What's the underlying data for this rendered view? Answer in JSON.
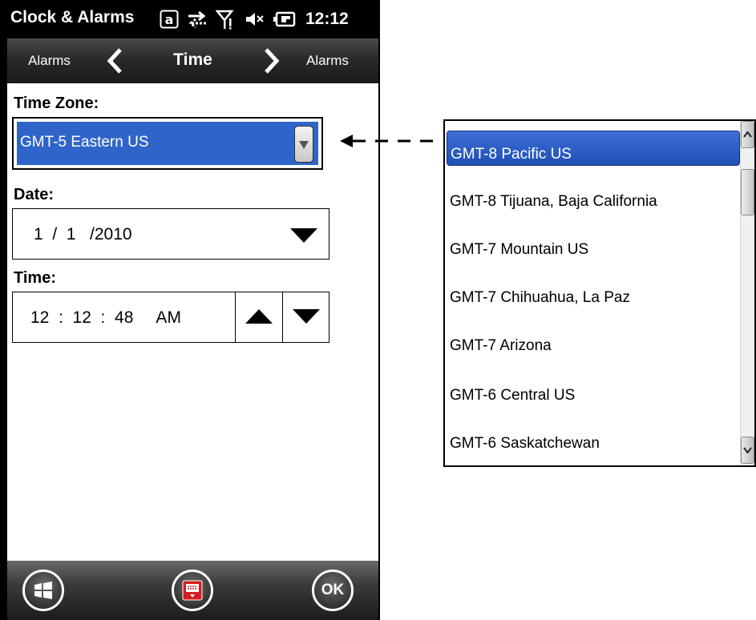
{
  "status_bar": {
    "app_title": "Clock & Alarms",
    "time": "12:12",
    "icons": [
      "keyboard-a-icon",
      "sync-arrows-icon",
      "signal-icon",
      "speaker-muted-icon",
      "battery-charging-icon"
    ]
  },
  "nav": {
    "prev_label": "Alarms",
    "title": "Time",
    "next_label": "Alarms"
  },
  "form": {
    "timezone_label": "Time Zone:",
    "timezone_value": "GMT-5 Eastern US",
    "date_label": "Date:",
    "date_value": "1  /  1   /2010",
    "time_label": "Time:",
    "time_value": "12  :  12  :  48     AM"
  },
  "bottom_bar": {
    "ok_label": "OK"
  },
  "timezone_list": {
    "items": [
      {
        "label": "GMT-8 Pacific US",
        "selected": true
      },
      {
        "label": "GMT-8 Tijuana, Baja California",
        "selected": false
      },
      {
        "label": "GMT-7 Mountain US",
        "selected": false
      },
      {
        "label": "GMT-7 Chihuahua, La Paz",
        "selected": false
      },
      {
        "label": "GMT-7 Arizona",
        "selected": false
      },
      {
        "label": "GMT-6 Central US",
        "selected": false
      },
      {
        "label": "GMT-6 Saskatchewan",
        "selected": false
      }
    ]
  },
  "colors": {
    "selection_blue": "#2f65c8",
    "bar_black": "#000000"
  }
}
